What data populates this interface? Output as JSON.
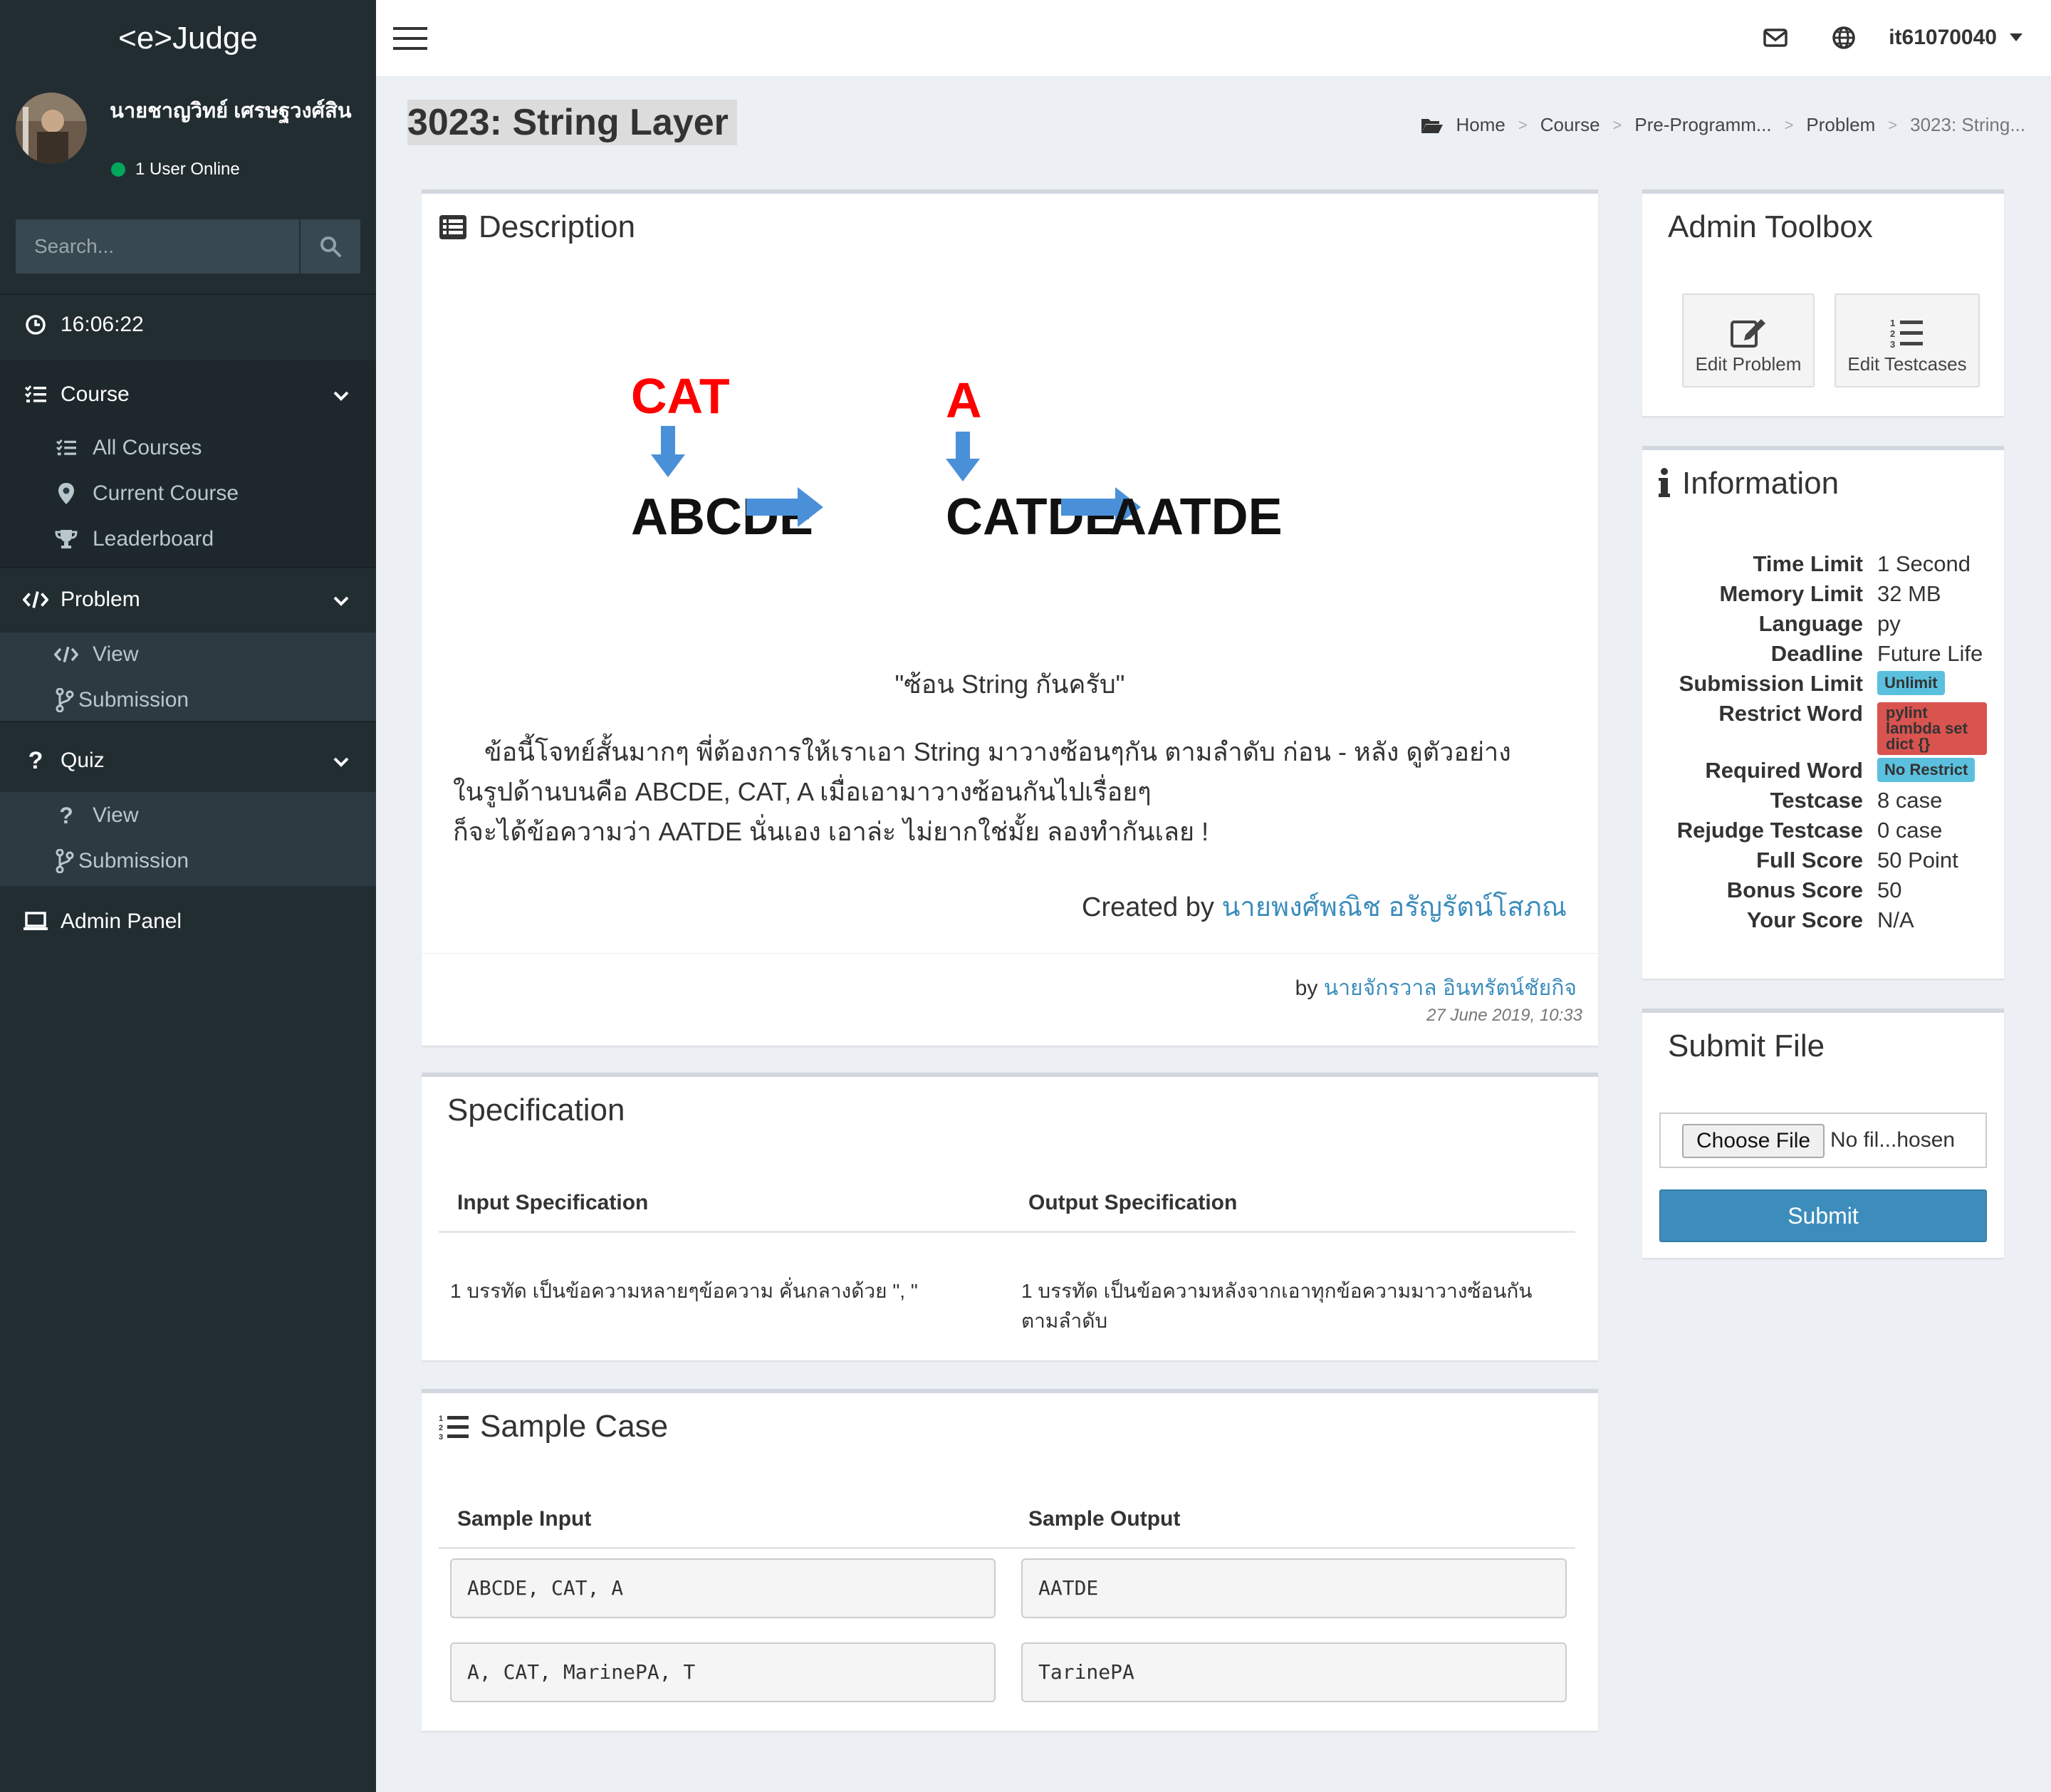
{
  "sidebar": {
    "brand": "<e>Judge",
    "user_name": "นายชาญวิทย์ เศรษฐวงศ์สิน",
    "online_text": "1 User Online",
    "search_placeholder": "Search...",
    "clock": "16:06:22",
    "course": {
      "label": "Course",
      "items": [
        {
          "label": "All Courses"
        },
        {
          "label": "Current Course"
        },
        {
          "label": "Leaderboard"
        }
      ]
    },
    "problem": {
      "label": "Problem",
      "items": [
        {
          "label": "View"
        },
        {
          "label": "Submission"
        }
      ]
    },
    "quiz": {
      "label": "Quiz",
      "items": [
        {
          "label": "View"
        },
        {
          "label": "Submission"
        }
      ]
    },
    "admin_panel": "Admin Panel"
  },
  "topbar": {
    "username": "it61070040"
  },
  "page": {
    "title": "3023: String Layer",
    "breadcrumb": [
      "Home",
      "Course",
      "Pre-Programm...",
      "Problem",
      "3023: String..."
    ]
  },
  "description": {
    "title": "Description",
    "figure": {
      "word1": "CAT",
      "word2": "A",
      "step1": "ABCDE",
      "step2": "CATDE",
      "step3": "AATDE"
    },
    "quote": "\"ซ้อน String กันครับ\"",
    "lines": [
      "ข้อนี้โจทย์สั้นมากๆ พี่ต้องการให้เราเอา String มาวางซ้อนๆกัน ตามลำดับ ก่อน - หลัง ดูตัวอย่าง",
      "ในรูปด้านบนคือ ABCDE, CAT, A เมื่อเอามาวางซ้อนกันไปเรื่อยๆ",
      "ก็จะได้ข้อความว่า AATDE นั่นเอง เอาล่ะ ไม่ยากใช่มั้ย ลองทำกันเลย !"
    ],
    "created_prefix": "Created by",
    "created_author": "นายพงศ์พณิช อรัญรัตน์โสภณ",
    "by_prefix": "by",
    "by_author": "นายจักรวาล อินทรัตน์ชัยกิจ",
    "date": "27 June 2019, 10:33"
  },
  "specification": {
    "title": "Specification",
    "input_header": "Input Specification",
    "output_header": "Output Specification",
    "input_text": "1 บรรทัด เป็นข้อความหลายๆข้อความ คั่นกลางด้วย \", \"",
    "output_text_1": "1 บรรทัด เป็นข้อความหลังจากเอาทุกข้อความมาวางซ้อนกัน",
    "output_text_2": "ตามลำดับ"
  },
  "sample": {
    "title": "Sample Case",
    "input_header": "Sample Input",
    "output_header": "Sample Output",
    "cases": [
      {
        "input": "ABCDE, CAT, A",
        "output": "AATDE"
      },
      {
        "input": "A, CAT, MarinePA, T",
        "output": "TarinePA"
      }
    ]
  },
  "toolbox": {
    "title": "Admin Toolbox",
    "edit_problem": "Edit Problem",
    "edit_testcases": "Edit Testcases"
  },
  "information": {
    "title": "Information",
    "rows": [
      {
        "k": "Time Limit",
        "v": "1 Second"
      },
      {
        "k": "Memory Limit",
        "v": "32 MB"
      },
      {
        "k": "Language",
        "v": "py"
      },
      {
        "k": "Deadline",
        "v": "Future Life"
      },
      {
        "k": "Submission Limit",
        "v": "Unlimit"
      },
      {
        "k": "Restrict Word",
        "v1": "pylint",
        "v2": "lambda set",
        "v3": "dict {}"
      },
      {
        "k": "Required Word",
        "v": "No Restrict"
      },
      {
        "k": "Testcase",
        "v": "8 case"
      },
      {
        "k": "Rejudge Testcase",
        "v": "0 case"
      },
      {
        "k": "Full Score",
        "v": "50 Point"
      },
      {
        "k": "Bonus Score",
        "v": "50"
      },
      {
        "k": "Your Score",
        "v": "N/A"
      }
    ]
  },
  "submit_file": {
    "title": "Submit File",
    "choose_label": "Choose File",
    "no_file": "No fil...hosen",
    "submit_label": "Submit"
  },
  "colors": {
    "sidebar": "#222d32",
    "accent": "#3c8dbc",
    "badge_info": "#5bc0de",
    "badge_danger": "#d9534f",
    "arrow": "#4a90d9",
    "figure_red": "#ff0000"
  }
}
